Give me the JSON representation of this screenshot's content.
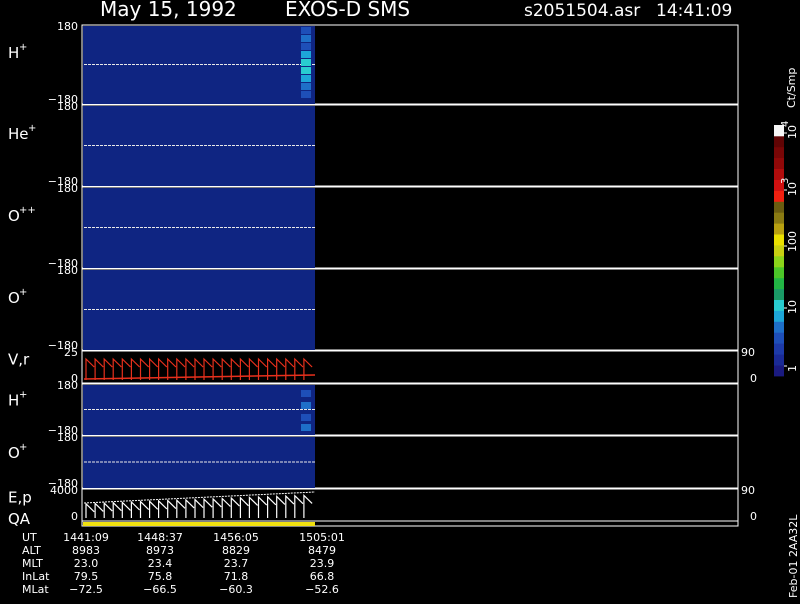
{
  "header": {
    "date": "May 15, 1992",
    "instrument": "EXOS-D SMS",
    "filename": "s2051504.asr",
    "time": "14:41:09"
  },
  "colorbar": {
    "title": "Ct/Smp",
    "tick_labels": [
      "1",
      "10",
      "100",
      "10",
      "10"
    ],
    "tick_exponents": [
      "",
      "",
      "",
      "3",
      "4"
    ],
    "colors": [
      "#1a1a80",
      "#1a2a96",
      "#1d3aa8",
      "#1e4fb8",
      "#1e6fc8",
      "#1da6d8",
      "#29ccd0",
      "#1a9a66",
      "#22b544",
      "#4cc528",
      "#8cd41a",
      "#c8d012",
      "#eae000",
      "#b8a010",
      "#8a7a12",
      "#6a5c10",
      "#f02010",
      "#d01010",
      "#b00c0c",
      "#900808",
      "#780606",
      "#600404",
      "#f6f6f6"
    ]
  },
  "panels": [
    {
      "label": "H",
      "sup": "+",
      "ymax": "180",
      "ymin": "−180"
    },
    {
      "label": "He",
      "sup": "+",
      "ymax": "180",
      "ymin": "−180"
    },
    {
      "label": "O",
      "sup": "++",
      "ymax": "180",
      "ymin": "−180"
    },
    {
      "label": "O",
      "sup": "+",
      "ymax": "180",
      "ymin": "−180"
    },
    {
      "label": "V,r",
      "sup": "",
      "ymax": "25",
      "ymin": "0",
      "rmax": "90",
      "rmin": "0"
    },
    {
      "label": "H",
      "sup": "+",
      "ymax": "180",
      "ymin": "−180"
    },
    {
      "label": "O",
      "sup": "+",
      "ymax": "180",
      "ymin": "−180"
    },
    {
      "label": "E,p",
      "sup": "",
      "ymax": "4000",
      "ymin": "0",
      "rmax": "90",
      "rmin": "0"
    },
    {
      "label": "QA",
      "sup": ""
    }
  ],
  "side_note": "Feb-01 2AA32L",
  "footer": {
    "row_labels": [
      "UT",
      "ALT",
      "MLT",
      "InLat",
      "MLat"
    ],
    "columns": [
      [
        "1441:09",
        "8983",
        "23.0",
        "79.5",
        "−72.5"
      ],
      [
        "1448:37",
        "8973",
        "23.4",
        "75.8",
        "−66.5"
      ],
      [
        "1456:05",
        "8829",
        "23.7",
        "71.8",
        "−60.3"
      ],
      [
        "1505:01",
        "8479",
        "23.9",
        "66.8",
        "−52.6"
      ]
    ]
  },
  "colors": {
    "background": "#000000",
    "data_fill": "#0f2582",
    "trace_red": "#e8301c",
    "qa_yellow": "#f0e010"
  },
  "chart_data": {
    "type": "heatmap",
    "data_coverage_fraction": 0.27
  }
}
